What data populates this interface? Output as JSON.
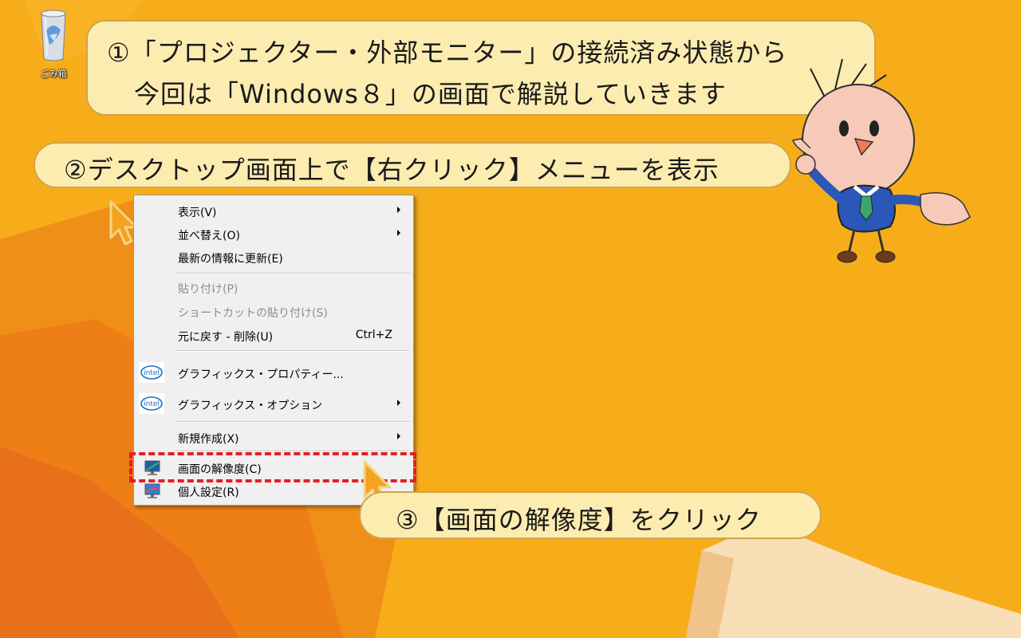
{
  "desktop": {
    "recycle_bin_label": "ごみ箱"
  },
  "callouts": {
    "step1_line1": "①「プロジェクター・外部モニター」の接続済み状態から",
    "step1_line2": "今回は「Windows８」の画面で解説していきます",
    "step2": "②デスクトップ画面上で【右クリック】メニューを表示",
    "step3": "③【画面の解像度】をクリック"
  },
  "context_menu": {
    "view": "表示(V)",
    "sort_by": "並べ替え(O)",
    "refresh": "最新の情報に更新(E)",
    "paste": "貼り付け(P)",
    "paste_shortcut": "ショートカットの貼り付け(S)",
    "undo_delete": "元に戻す - 削除(U)",
    "undo_shortcut": "Ctrl+Z",
    "graphics_properties": "グラフィックス・プロパティー...",
    "graphics_options": "グラフィックス・オプション",
    "new": "新規作成(X)",
    "screen_resolution": "画面の解像度(C)",
    "personalize": "個人設定(R)",
    "intel_label": "intel"
  },
  "colors": {
    "wallpaper": "#f7ad1a",
    "callout_fill": "#fcecb0",
    "highlight": "#e41f26"
  }
}
